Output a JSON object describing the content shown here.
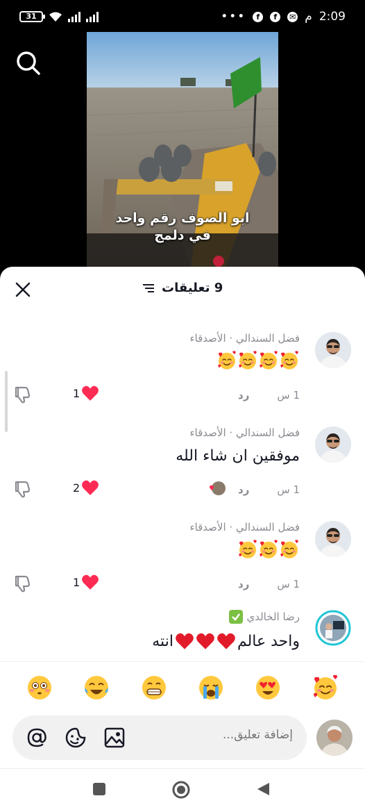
{
  "status": {
    "battery": "31",
    "time": "2:09",
    "ampm": "م"
  },
  "video": {
    "caption_line1": "ابو الصوف رقم واحد",
    "caption_line2": "في دلمج"
  },
  "sheet": {
    "title": "9 تعليقات"
  },
  "comments": [
    {
      "author": "فضل السندالي · الأصدقاء",
      "text": "",
      "time": "1 س",
      "reply": "رد",
      "likes": "1",
      "emoji_count": 4
    },
    {
      "author": "فضل السندالي · الأصدقاء",
      "text": "موفقين ان شاء الله",
      "time": "1 س",
      "reply": "رد",
      "likes": "2"
    },
    {
      "author": "فضل السندالي · الأصدقاء",
      "text": "",
      "time": "1 س",
      "reply": "رد",
      "likes": "1",
      "emoji_count": 3
    },
    {
      "author": "رضا الخالدي",
      "text_before": "واحد عالم",
      "text_after": "انته"
    }
  ],
  "emoji_bar": [
    "smiling-face-with-hearts",
    "heart-eyes",
    "crying",
    "grinning",
    "tears-of-joy",
    "flushed"
  ],
  "input": {
    "placeholder": "إضافة تعليق..."
  },
  "colors": {
    "like_red": "#fe2c55",
    "text_dark": "#161823",
    "text_gray": "#8a8b91"
  }
}
